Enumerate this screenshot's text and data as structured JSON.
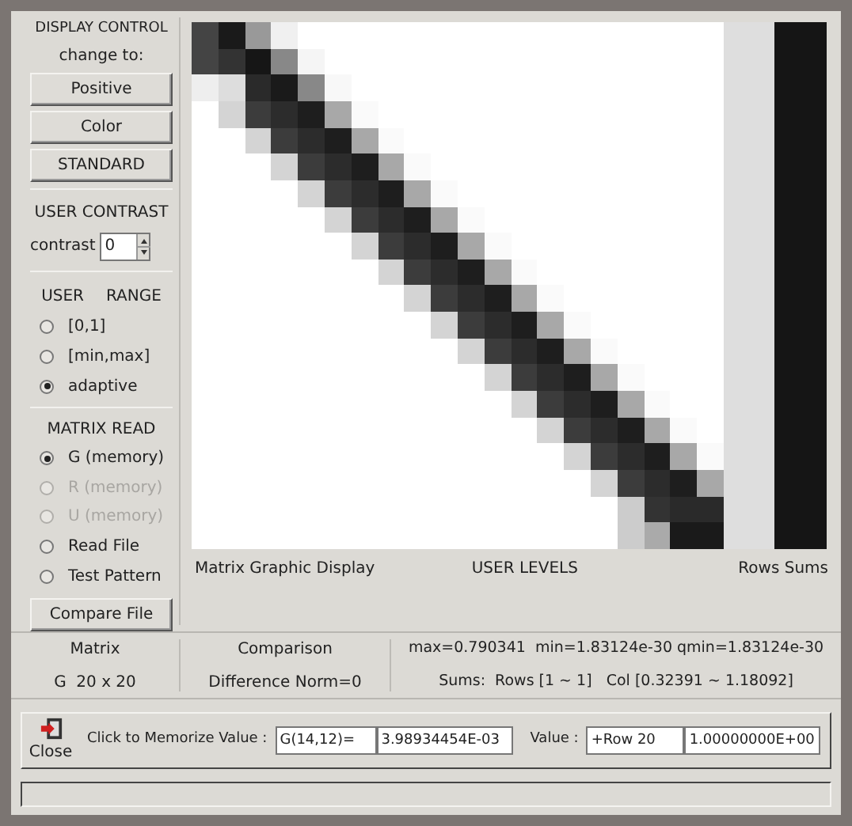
{
  "display_control": {
    "title": "DISPLAY CONTROL",
    "subtitle": "change to:",
    "buttons": [
      "Positive",
      "Color",
      "STANDARD"
    ]
  },
  "user_contrast": {
    "title": "USER CONTRAST",
    "label": "contrast",
    "value": "0"
  },
  "user_range": {
    "titles": [
      "USER",
      "RANGE"
    ],
    "options": [
      {
        "label": "[0,1]",
        "selected": false
      },
      {
        "label": "[min,max]",
        "selected": false
      },
      {
        "label": "adaptive",
        "selected": true
      }
    ]
  },
  "matrix_read": {
    "title": "MATRIX READ",
    "options": [
      {
        "label": "G (memory)",
        "selected": true,
        "disabled": false
      },
      {
        "label": "R (memory)",
        "selected": false,
        "disabled": true
      },
      {
        "label": "U (memory)",
        "selected": false,
        "disabled": true
      },
      {
        "label": "Read File",
        "selected": false,
        "disabled": false
      },
      {
        "label": "Test Pattern",
        "selected": false,
        "disabled": false
      }
    ],
    "button": "Compare File"
  },
  "display": {
    "labels": [
      "Matrix Graphic Display",
      "USER LEVELS",
      "Rows Sums"
    ]
  },
  "info": {
    "matrix": [
      "Matrix",
      "G  20 x 20"
    ],
    "comparison": [
      "Comparison",
      "Difference Norm=0"
    ],
    "stats": [
      "max=0.790341  min=1.83124e-30 qmin=1.83124e-30",
      "Sums:  Rows [1 ~ 1]   Col [0.32391 ~ 1.18092]"
    ]
  },
  "toolbar": {
    "close": "Close",
    "memorize_label": "Click to Memorize Value :",
    "memorize_fields": [
      "G(14,12)=",
      "3.98934454E-03"
    ],
    "value_label": "Value :",
    "value_fields": [
      "+Row 20",
      "1.00000000E+00"
    ]
  }
}
